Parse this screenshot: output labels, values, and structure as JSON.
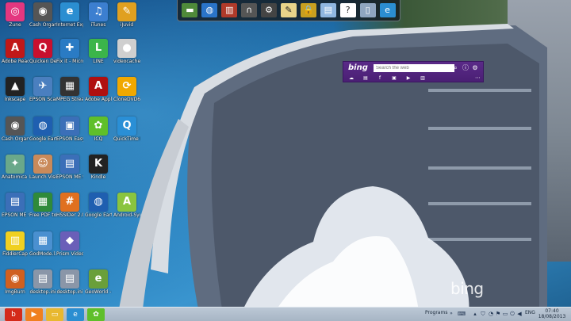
{
  "desktop": {
    "icons": [
      {
        "label": "Zune",
        "icon": "zune-icon",
        "color": "#e4377f",
        "glyph": "◎"
      },
      {
        "label": "Cash Organizer...",
        "icon": "cash-organizer-icon",
        "color": "#555555",
        "glyph": "◉"
      },
      {
        "label": "Internet Explorer Tr...",
        "icon": "internet-explorer-icon",
        "color": "#2b8ed1",
        "glyph": "e"
      },
      {
        "label": "iTunes",
        "icon": "itunes-icon",
        "color": "#3c7fd0",
        "glyph": "♫"
      },
      {
        "label": "iJuvid",
        "icon": "ijuvid-icon",
        "color": "#e0a020",
        "glyph": "✎"
      },
      {
        "label": "Adobe Reader XI",
        "icon": "adobe-reader-icon",
        "color": "#c01818",
        "glyph": "A"
      },
      {
        "label": "Quicken Deluxe 2010",
        "icon": "quicken-icon",
        "color": "#c8102e",
        "glyph": "Q"
      },
      {
        "label": "Fix it - Microso...",
        "icon": "fix-it-icon",
        "color": "#2a7bc4",
        "glyph": "✚"
      },
      {
        "label": "LINE",
        "icon": "line-icon",
        "color": "#3bb54a",
        "glyph": "L"
      },
      {
        "label": "videocache...",
        "icon": "videocache-icon",
        "color": "#cfcfcf",
        "glyph": "●"
      },
      {
        "label": "Inkscape",
        "icon": "inkscape-icon",
        "color": "#222222",
        "glyph": "▲"
      },
      {
        "label": "EPSON Scan",
        "icon": "epson-scan-icon",
        "color": "#4a7fbf",
        "glyph": "✈"
      },
      {
        "label": "MPEG Streamclip",
        "icon": "mpeg-streamclip-icon",
        "color": "#333333",
        "glyph": "▦"
      },
      {
        "label": "Adobe Applicati...",
        "icon": "adobe-application-icon",
        "color": "#b01010",
        "glyph": "A"
      },
      {
        "label": "CloneDVD6",
        "icon": "clonedvd-icon",
        "color": "#f0a800",
        "glyph": "⟳"
      },
      {
        "label": "Cash Organiz...",
        "icon": "cash-organizer-2-icon",
        "color": "#555555",
        "glyph": "◉"
      },
      {
        "label": "Google Earth",
        "icon": "google-earth-icon",
        "color": "#1f5fb0",
        "glyph": "◍"
      },
      {
        "label": "EPSON Easy Photo Print",
        "icon": "epson-photo-print-icon",
        "color": "#3b6fb8",
        "glyph": "▣"
      },
      {
        "label": "ICQ",
        "icon": "icq-icon",
        "color": "#5fbf2a",
        "glyph": "✿"
      },
      {
        "label": "QuickTime Player",
        "icon": "quicktime-icon",
        "color": "#2a8fd6",
        "glyph": "Q"
      },
      {
        "label": "Anatomica Advanced...",
        "icon": "anatomica-icon",
        "color": "#6aa88a",
        "glyph": "✦"
      },
      {
        "label": "Launch Visible Bo...",
        "icon": "launch-visible-body-icon",
        "color": "#c98a5a",
        "glyph": "☺"
      },
      {
        "label": "EPSON ME 900WD S...",
        "icon": "epson-me-icon",
        "color": "#3b6fb8",
        "glyph": "▤"
      },
      {
        "label": "Kindle",
        "icon": "kindle-icon",
        "color": "#222222",
        "glyph": "K"
      },
      {
        "label": "EPSON ME 900WD S...",
        "icon": "epson-me-2-icon",
        "color": "#3b6fb8",
        "glyph": "▤"
      },
      {
        "label": "Free PDF to Word Do...",
        "icon": "free-pdf-icon",
        "color": "#2f8a3a",
        "glyph": "▦"
      },
      {
        "label": "HSSIDer 2.0",
        "icon": "hssider-icon",
        "color": "#e07020",
        "glyph": "#"
      },
      {
        "label": "Google Earth",
        "icon": "google-earth-2-icon",
        "color": "#1f5fb0",
        "glyph": "◍"
      },
      {
        "label": "Android-Sync",
        "icon": "android-sync-icon",
        "color": "#8ac43f",
        "glyph": "A"
      },
      {
        "label": "FiddlerCap",
        "icon": "fiddlercap-icon",
        "color": "#f0d020",
        "glyph": "▥"
      },
      {
        "label": "GodMode.l...",
        "icon": "godmode-icon",
        "color": "#4a90d0",
        "glyph": "▦"
      },
      {
        "label": "Prism Video File Converter",
        "icon": "prism-icon",
        "color": "#6a5fb8",
        "glyph": "◆"
      },
      {
        "label": "ImgBurn",
        "icon": "imgburn-icon",
        "color": "#d06020",
        "glyph": "◉"
      },
      {
        "label": "desktop.ini",
        "icon": "desktop-ini-icon",
        "color": "#8a96a8",
        "glyph": "▤"
      },
      {
        "label": "desktop.ini",
        "icon": "desktop-ini-2-icon",
        "color": "#8a96a8",
        "glyph": "▤"
      },
      {
        "label": "GeoWorld - Alldocu...",
        "icon": "geoworld-icon",
        "color": "#6a9f3a",
        "glyph": "e"
      }
    ]
  },
  "top_toolbar": {
    "buttons": [
      {
        "icon": "landscape-icon",
        "color": "#4f8a3a",
        "glyph": "▬"
      },
      {
        "icon": "globe-icon",
        "color": "#2a74c8",
        "glyph": "◍"
      },
      {
        "icon": "library-icon",
        "color": "#b03a2a",
        "glyph": "▥"
      },
      {
        "icon": "headphones-icon",
        "color": "#555555",
        "glyph": "∩"
      },
      {
        "icon": "settings-icon",
        "color": "#444444",
        "glyph": "⚙"
      },
      {
        "icon": "notepad-icon",
        "color": "#e8d48a",
        "glyph": "✎"
      },
      {
        "icon": "lock-icon",
        "color": "#c8a020",
        "glyph": "🔒"
      },
      {
        "icon": "document-icon",
        "color": "#8fb6e0",
        "glyph": "▤"
      },
      {
        "icon": "help-icon",
        "color": "#ffffff",
        "glyph": "?"
      },
      {
        "icon": "recycle-bin-icon",
        "color": "#8fa6c0",
        "glyph": "▯"
      },
      {
        "icon": "internet-explorer-icon",
        "color": "#2b8ed1",
        "glyph": "e"
      }
    ]
  },
  "bing_bar": {
    "logo": "bing",
    "search_placeholder": "Search the web",
    "sub_icons": [
      "weather-icon",
      "news-icon",
      "facebook-icon",
      "images-icon",
      "video-icon",
      "maps-icon"
    ],
    "more": "⋯"
  },
  "watermark": "bing",
  "taskbar": {
    "apps": [
      {
        "icon": "bitdefender-icon",
        "color": "#d42a1a",
        "glyph": "b"
      },
      {
        "icon": "media-player-icon",
        "color": "#f08020",
        "glyph": "▶"
      },
      {
        "icon": "file-explorer-icon",
        "color": "#e8b830",
        "glyph": "▭"
      },
      {
        "icon": "internet-explorer-icon",
        "color": "#2b8ed1",
        "glyph": "e"
      },
      {
        "icon": "icq-icon",
        "color": "#5fbf2a",
        "glyph": "✿"
      }
    ],
    "programs_label": "Programs",
    "language": "ENG",
    "time": "07:40",
    "date": "18/08/2013"
  }
}
